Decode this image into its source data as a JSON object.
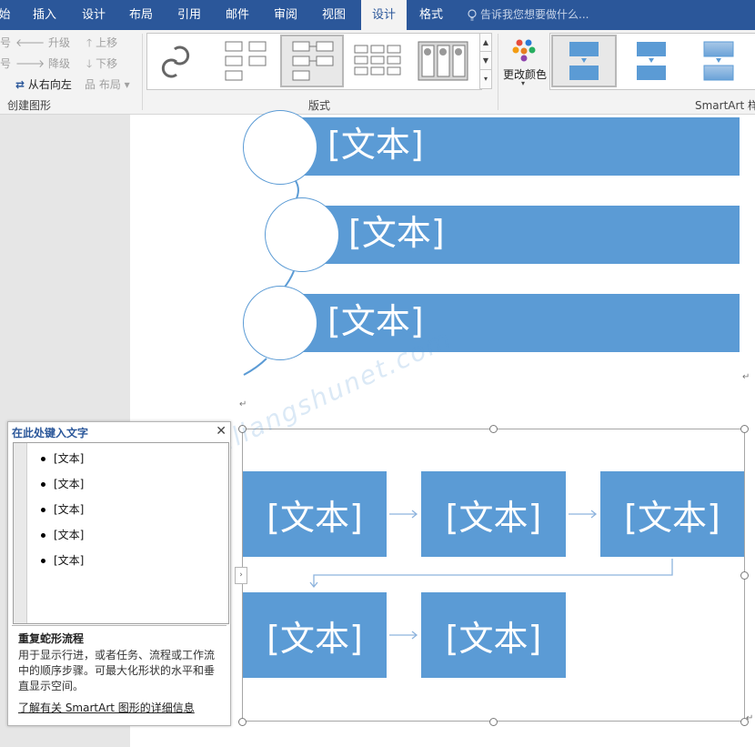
{
  "tabs": [
    "始",
    "插入",
    "设计",
    "布局",
    "引用",
    "邮件",
    "审阅",
    "视图",
    "设计",
    "格式"
  ],
  "active_tab_index": 8,
  "tell_me_placeholder": "告诉我您想要做什么...",
  "ribbon": {
    "create_graphic": {
      "promote": "升级",
      "demote": "降级",
      "right_to_left": "从右向左",
      "move_up": "上移",
      "move_down": "下移",
      "layout": "布局",
      "left_cut_1": "号",
      "left_cut_2": "号",
      "group_label": "创建图形"
    },
    "layouts": {
      "group_label": "版式"
    },
    "change_colors": "更改颜色",
    "smartart_styles_label": "SmartArt 样"
  },
  "document": {
    "placeholder_text": "[文本]",
    "accent_color": "#5b9bd5"
  },
  "text_pane": {
    "title": "在此处键入文字",
    "items": [
      "[文本]",
      "[文本]",
      "[文本]",
      "[文本]",
      "[文本]"
    ],
    "layout_name": "重复蛇形流程",
    "layout_description": "用于显示行进，或者任务、流程或工作流中的顺序步骤。可最大化形状的水平和垂直显示空间。",
    "learn_more": "了解有关 SmartArt 图形的详细信息"
  },
  "watermark": "亮术网 www.liangshunet.com"
}
